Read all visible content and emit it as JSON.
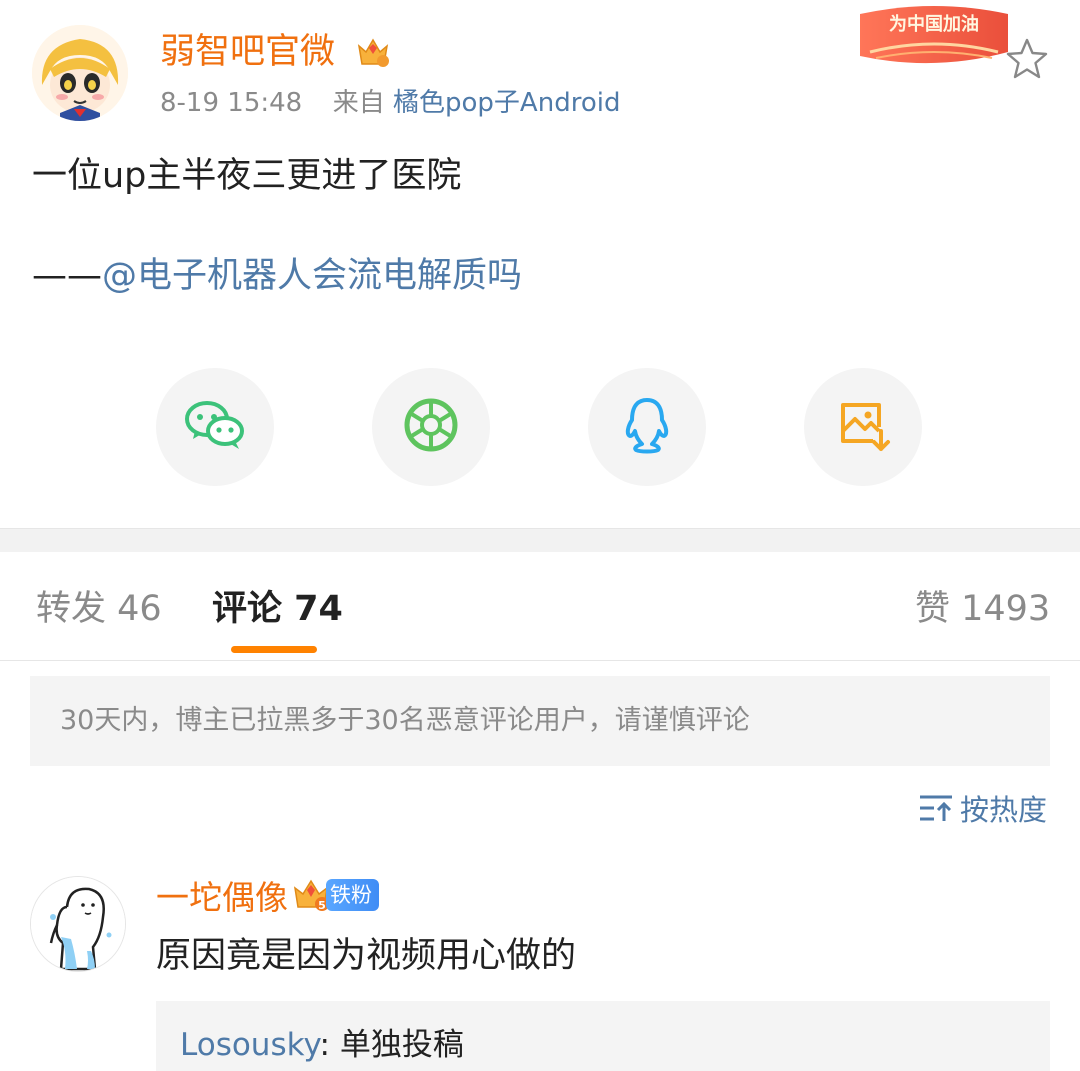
{
  "post": {
    "author": "弱智吧官微",
    "time": "8-19 15:48",
    "source_prefix": "来自",
    "source": "橘色pop子Android",
    "promo_badge": "为中国加油",
    "text": "一位up主半夜三更进了医院",
    "credit_prefix": "——",
    "credit_mention": "@电子机器人会流电解质吗"
  },
  "share": [
    {
      "icon": "wechat-icon",
      "color": "#3cc27a"
    },
    {
      "icon": "moments-icon",
      "color": "#5ec45e"
    },
    {
      "icon": "qq-icon",
      "color": "#29a8f0"
    },
    {
      "icon": "save-image-icon",
      "color": "#f5a623"
    }
  ],
  "tabs": {
    "repost": "转发 46",
    "comment": "评论 74",
    "like": "赞 1493"
  },
  "notice": "30天内，博主已拉黑多于30名恶意评论用户，请谨慎评论",
  "sort": {
    "label": "按热度",
    "icon": "sort-icon"
  },
  "comments": [
    {
      "user": "一坨偶像",
      "badge": "铁粉",
      "vip_level": "5",
      "text": "原因竟是因为视频用心做的",
      "reply": {
        "user": "Losousky",
        "separator": ": ",
        "text": "单独投稿"
      }
    }
  ],
  "colors": {
    "accent": "#ff8200",
    "username": "#f0700f",
    "link": "#4f7aa8"
  }
}
